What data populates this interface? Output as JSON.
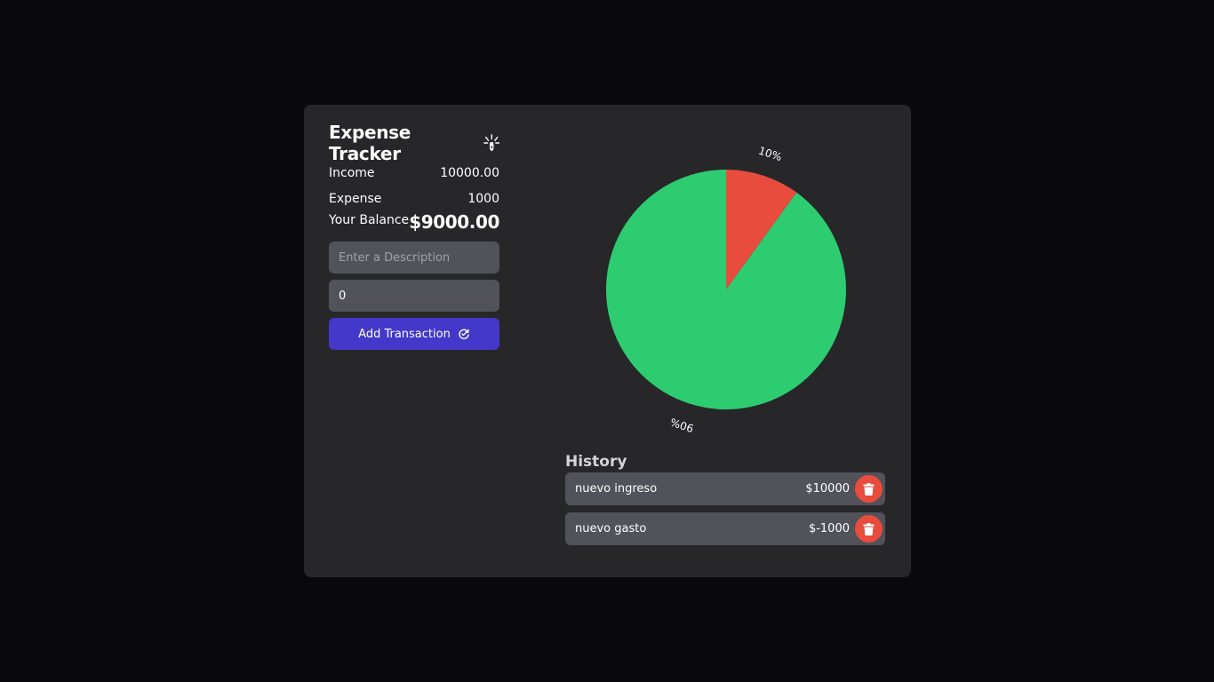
{
  "app": {
    "title": "Expense Tracker"
  },
  "summary": {
    "income_label": "Income",
    "income_value": "10000.00",
    "expense_label": "Expense",
    "expense_value": "1000",
    "balance_label": "Your Balance",
    "balance_value": "$9000.00"
  },
  "form": {
    "description_placeholder": "Enter a Description",
    "description_value": "",
    "amount_value": "0",
    "submit_label": "Add Transaction"
  },
  "chart_data": {
    "type": "pie",
    "slices": [
      {
        "label": "10%",
        "value": 10,
        "color": "#e74c3c"
      },
      {
        "label": "90%",
        "value": 90,
        "color": "#2ecc71"
      }
    ]
  },
  "history": {
    "title": "History",
    "items": [
      {
        "description": "nuevo ingreso",
        "amount": "$10000"
      },
      {
        "description": "nuevo gasto",
        "amount": "$-1000"
      }
    ]
  },
  "icons": {
    "title_icon": "sparkle-fountain-pen-icon",
    "submit_icon": "refresh-cycle-icon",
    "delete_icon": "trash-icon"
  }
}
